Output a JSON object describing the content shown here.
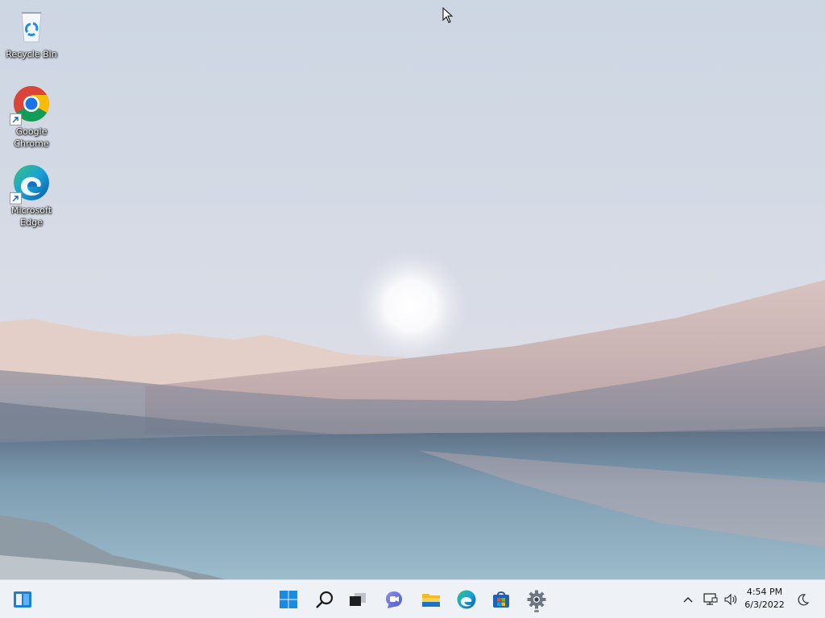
{
  "desktop": {
    "icons": [
      {
        "label": "Recycle Bin",
        "icon": "recycle-bin-icon"
      },
      {
        "label": "Google Chrome",
        "icon": "chrome-icon"
      },
      {
        "label": "Microsoft Edge",
        "icon": "edge-icon"
      }
    ]
  },
  "taskbar": {
    "items": [
      {
        "name": "widgets",
        "icon": "widgets-icon"
      },
      {
        "name": "start",
        "icon": "windows-start-icon"
      },
      {
        "name": "search",
        "icon": "search-icon"
      },
      {
        "name": "task-view",
        "icon": "task-view-icon"
      },
      {
        "name": "chat",
        "icon": "teams-chat-icon"
      },
      {
        "name": "file-explorer",
        "icon": "folder-icon"
      },
      {
        "name": "edge",
        "icon": "edge-icon"
      },
      {
        "name": "store",
        "icon": "store-icon"
      },
      {
        "name": "settings",
        "icon": "gear-icon"
      }
    ],
    "tray": {
      "chevron": "chevron-up-icon",
      "network": "network-icon",
      "volume": "speaker-icon",
      "time": "4:54 PM",
      "date": "6/3/2022",
      "focus": "moon-icon"
    }
  },
  "colors": {
    "taskbar_bg": "#eef1f6",
    "accent_blue": "#0078d4"
  }
}
